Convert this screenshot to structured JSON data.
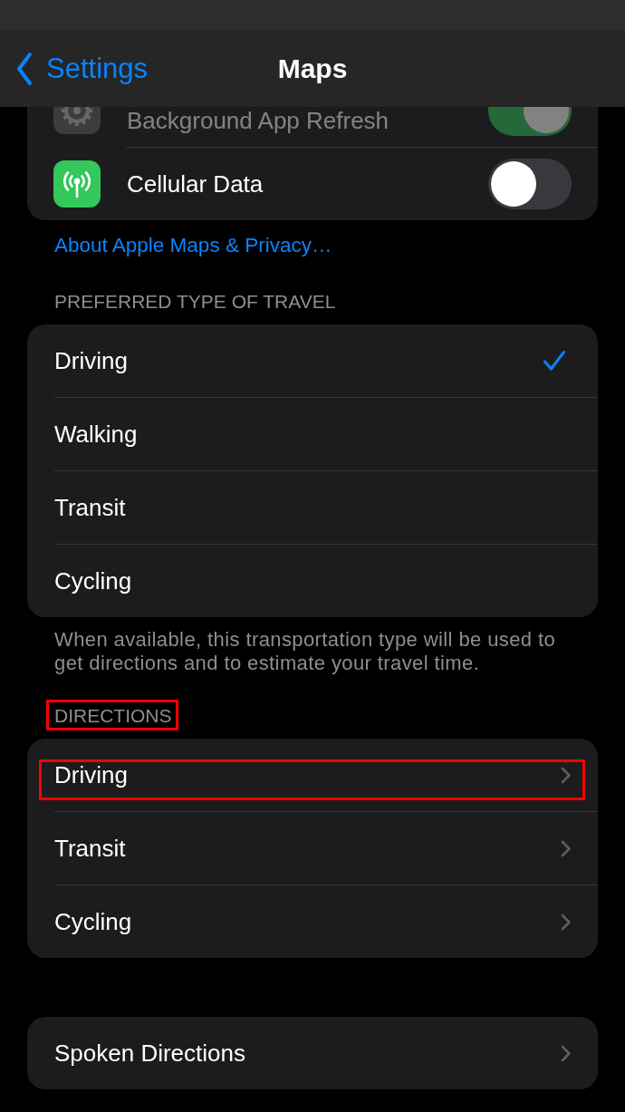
{
  "nav_bar": {
    "back_label": "Settings",
    "title": "Maps"
  },
  "access_group": {
    "rows": [
      {
        "label": "Background App Refresh",
        "on": true,
        "disabled": true
      },
      {
        "label": "Cellular Data",
        "on": false,
        "disabled": false
      }
    ]
  },
  "privacy_link": "About Apple Maps & Privacy…",
  "travel_section": {
    "header": "PREFERRED TYPE OF TRAVEL",
    "options": [
      {
        "label": "Driving",
        "selected": true
      },
      {
        "label": "Walking",
        "selected": false
      },
      {
        "label": "Transit",
        "selected": false
      },
      {
        "label": "Cycling",
        "selected": false
      }
    ],
    "footer": "When available, this transportation type will be used to get directions and to estimate your travel time."
  },
  "directions_section": {
    "header": "DIRECTIONS",
    "header_highlighted": true,
    "items": [
      {
        "label": "Driving",
        "highlighted": true
      },
      {
        "label": "Transit",
        "highlighted": false
      },
      {
        "label": "Cycling",
        "highlighted": false
      }
    ]
  },
  "spoken_directions": {
    "label": "Spoken Directions"
  }
}
